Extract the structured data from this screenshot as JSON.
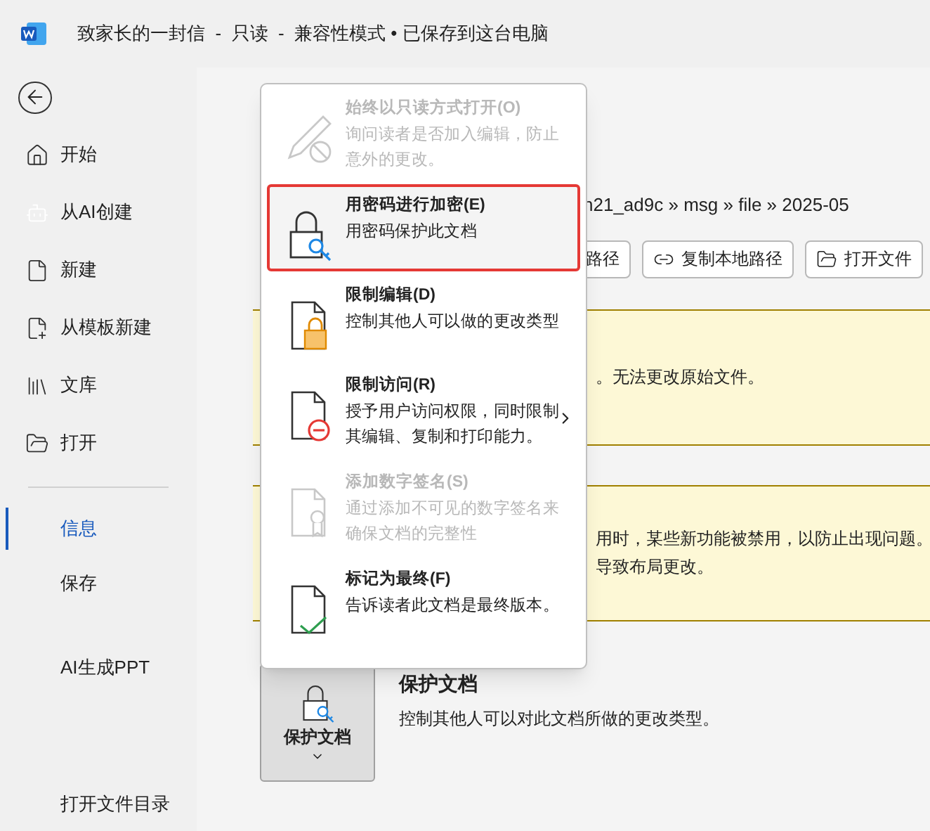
{
  "window": {
    "title": "致家长的一封信  -  只读  -  兼容性模式 • 已保存到这台电脑"
  },
  "sidebar": {
    "items": [
      {
        "label": "开始",
        "selected": false
      },
      {
        "label": "从AI创建",
        "selected": false
      },
      {
        "label": "新建",
        "selected": false
      },
      {
        "label": "从模板新建",
        "selected": false
      },
      {
        "label": "文库",
        "selected": false
      },
      {
        "label": "打开",
        "selected": false
      }
    ],
    "items_below": [
      {
        "label": "信息",
        "selected": true
      },
      {
        "label": "保存",
        "selected": false
      },
      {
        "label": "AI生成PPT",
        "selected": false
      },
      {
        "label": "打开文件目录",
        "selected": false
      }
    ]
  },
  "main": {
    "path": "n21_ad9c » msg » file » 2025-05",
    "path_buttons": [
      "路径",
      "复制本地路径",
      "打开文件"
    ],
    "banners": [
      {
        "lines": [
          "。无法更改原始文件。"
        ]
      },
      {
        "lines": [
          "用时，某些新功能被禁用，以防止出现问题。",
          "导致布局更改。"
        ]
      }
    ],
    "protect": {
      "button": "保护文档",
      "title": "保护文档",
      "description": "控制其他人可以对此文档所做的更改类型。"
    }
  },
  "menu": {
    "items": [
      {
        "title": "始终以只读方式打开(O)",
        "description": "询问读者是否加入编辑，防止意外的更改。",
        "disabled": true,
        "selected": false,
        "submenu": false
      },
      {
        "title": "用密码进行加密(E)",
        "description": "用密码保护此文档",
        "disabled": false,
        "selected": true,
        "submenu": false
      },
      {
        "title": "限制编辑(D)",
        "description": "控制其他人可以做的更改类型",
        "disabled": false,
        "selected": false,
        "submenu": false
      },
      {
        "title": "限制访问(R)",
        "description": "授予用户访问权限，同时限制其编辑、复制和打印能力。",
        "disabled": false,
        "selected": false,
        "submenu": true
      },
      {
        "title": "添加数字签名(S)",
        "description": "通过添加不可见的数字签名来确保文档的完整性",
        "disabled": true,
        "selected": false,
        "submenu": false
      },
      {
        "title": "标记为最终(F)",
        "description": "告诉读者此文档是最终版本。",
        "disabled": false,
        "selected": false,
        "submenu": false
      }
    ]
  }
}
